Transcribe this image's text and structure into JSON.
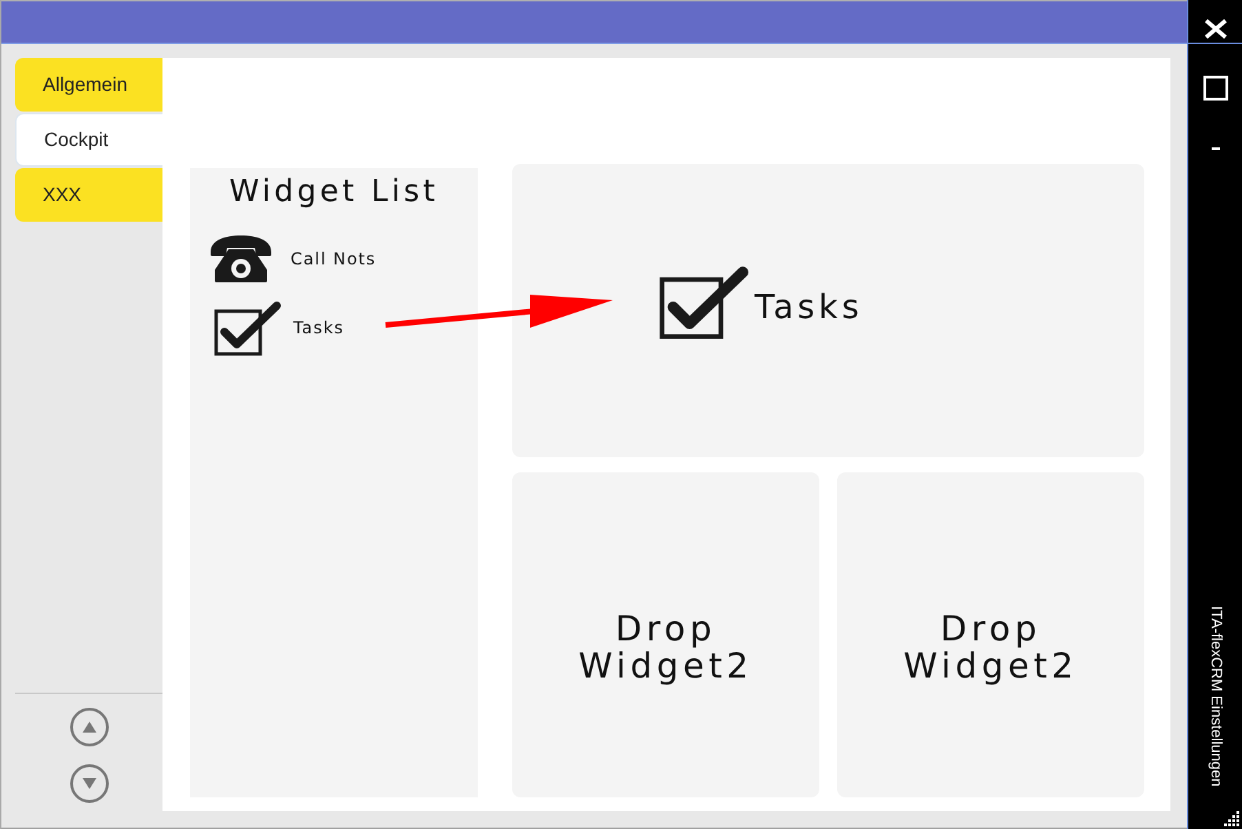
{
  "tabs": [
    {
      "label": "Allgemein",
      "selected": false
    },
    {
      "label": "Cockpit",
      "selected": true
    },
    {
      "label": "XXX",
      "selected": false
    }
  ],
  "scroll_buttons": [
    {
      "kind": "up"
    },
    {
      "kind": "down"
    }
  ],
  "widget_list": {
    "title": "Widget List",
    "items": [
      {
        "kind": "phone",
        "label": "Call Nots"
      },
      {
        "kind": "tasks",
        "label": "Tasks"
      }
    ]
  },
  "dashboard": {
    "widget": {
      "kind": "tasks",
      "label": "Tasks"
    },
    "drop_zones": [
      {
        "label": "Drop Widget2"
      },
      {
        "label": "Drop Widget2"
      }
    ]
  },
  "window_controls": [
    {
      "kind": "close"
    },
    {
      "kind": "maximize"
    },
    {
      "kind": "minimize"
    }
  ],
  "side_caption": "ITA-flexCRM Einstellungen"
}
